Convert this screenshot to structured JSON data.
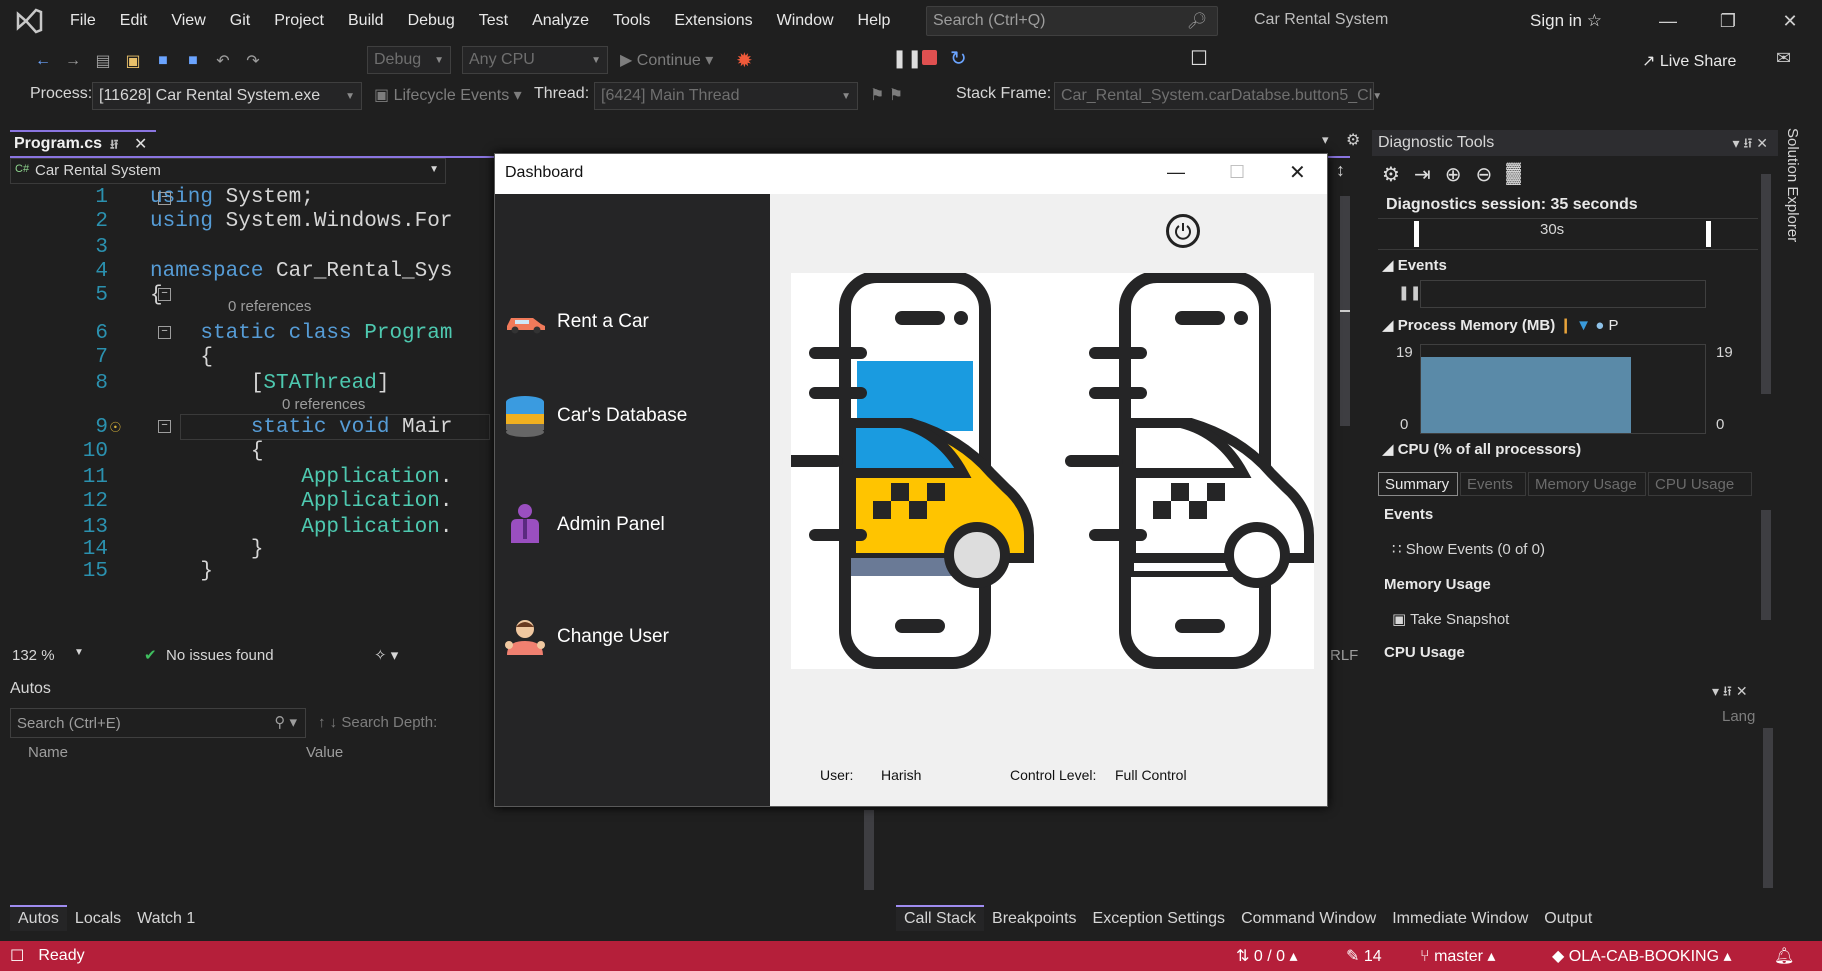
{
  "menu": [
    "File",
    "Edit",
    "View",
    "Git",
    "Project",
    "Build",
    "Debug",
    "Test",
    "Analyze",
    "Tools",
    "Extensions",
    "Window",
    "Help"
  ],
  "search": {
    "placeholder": "Search (Ctrl+Q)"
  },
  "solution_title": "Car Rental System",
  "signin": "Sign in",
  "live_share": "Live Share",
  "toolbar": {
    "config": "Debug",
    "platform": "Any CPU",
    "continue": "Continue"
  },
  "debugbar": {
    "process_label": "Process:",
    "process_value": "[11628] Car Rental System.exe",
    "lifecycle": "Lifecycle Events",
    "thread_label": "Thread:",
    "thread_value": "[6424] Main Thread",
    "stack_label": "Stack Frame:",
    "stack_value": "Car_Rental_System.carDatabse.button5_Cl"
  },
  "editor": {
    "tab": "Program.cs",
    "nav_project": "Car Rental System",
    "lines": [
      {
        "n": "1",
        "code": [
          {
            "k": "kw",
            "t": "using"
          },
          {
            "k": "",
            "t": " System;"
          }
        ]
      },
      {
        "n": "2",
        "code": [
          {
            "k": "kw",
            "t": "using"
          },
          {
            "k": "",
            "t": " System.Windows.For"
          }
        ]
      },
      {
        "n": "3",
        "code": []
      },
      {
        "n": "4",
        "code": [
          {
            "k": "kw",
            "t": "namespace"
          },
          {
            "k": "",
            "t": " Car_Rental_Sys"
          }
        ]
      },
      {
        "n": "5",
        "code": [
          {
            "k": "",
            "t": "{"
          }
        ]
      },
      {
        "n": "6",
        "code": [
          {
            "k": "kw",
            "t": "    static class"
          },
          {
            "k": "ty",
            "t": " Program"
          }
        ]
      },
      {
        "n": "7",
        "code": [
          {
            "k": "",
            "t": "    {"
          }
        ]
      },
      {
        "n": "8",
        "code": [
          {
            "k": "",
            "t": "        ["
          },
          {
            "k": "ty",
            "t": "STAThread"
          },
          {
            "k": "",
            "t": "]"
          }
        ]
      },
      {
        "n": "9",
        "code": [
          {
            "k": "kw",
            "t": "        static void"
          },
          {
            "k": "",
            "t": " Mair"
          }
        ]
      },
      {
        "n": "10",
        "code": [
          {
            "k": "",
            "t": "        {"
          }
        ]
      },
      {
        "n": "11",
        "code": [
          {
            "k": "ty",
            "t": "            Application"
          },
          {
            "k": "",
            "t": "."
          }
        ]
      },
      {
        "n": "12",
        "code": [
          {
            "k": "ty",
            "t": "            Application"
          },
          {
            "k": "",
            "t": "."
          }
        ]
      },
      {
        "n": "13",
        "code": [
          {
            "k": "ty",
            "t": "            Application"
          },
          {
            "k": "",
            "t": "."
          }
        ]
      },
      {
        "n": "14",
        "code": [
          {
            "k": "",
            "t": "        }"
          }
        ]
      },
      {
        "n": "15",
        "code": [
          {
            "k": "",
            "t": "    }"
          }
        ]
      }
    ],
    "references": "0 references",
    "zoom": "132 %",
    "issues": "No issues found",
    "eol": "RLF"
  },
  "autos": {
    "title": "Autos",
    "search_placeholder": "Search (Ctrl+E)",
    "search_depth": "Search Depth:",
    "col_name": "Name",
    "col_value": "Value",
    "lang": "Lang"
  },
  "bottom_tabs_left": [
    "Autos",
    "Locals",
    "Watch 1"
  ],
  "bottom_tabs_right": [
    "Call Stack",
    "Breakpoints",
    "Exception Settings",
    "Command Window",
    "Immediate Window",
    "Output"
  ],
  "diagnostics": {
    "title": "Diagnostic Tools",
    "session": "Diagnostics session: 35 seconds",
    "timeline_mark": "30s",
    "events": "Events",
    "process_memory": "Process Memory (MB)",
    "legend_p": "P",
    "mem_max": "19",
    "mem_min": "0",
    "memory_fill": 0.86,
    "cpu": "CPU (% of all processors)",
    "tabs": [
      "Summary",
      "Events",
      "Memory Usage",
      "CPU Usage"
    ],
    "summary_events": "Events",
    "show_events": "Show Events (0 of 0)",
    "memory_usage": "Memory Usage",
    "take_snapshot": "Take Snapshot",
    "cpu_usage": "CPU Usage"
  },
  "solution_explorer": "Solution Explorer",
  "dashboard": {
    "title": "Dashboard",
    "items": [
      "Rent a Car",
      "Car's Database",
      "Admin Panel",
      "Change User"
    ],
    "user_label": "User:",
    "user_value": "Harish",
    "control_label": "Control Level:",
    "control_value": "Full Control",
    "colors": {
      "taxi_yellow": "#ffc400",
      "sky": "#1a9be0",
      "dark": "#252526"
    }
  },
  "status": {
    "ready": "Ready",
    "lines": "0 / 0",
    "edits": "14",
    "branch": "master",
    "repo": "OLA-CAB-BOOKING"
  }
}
